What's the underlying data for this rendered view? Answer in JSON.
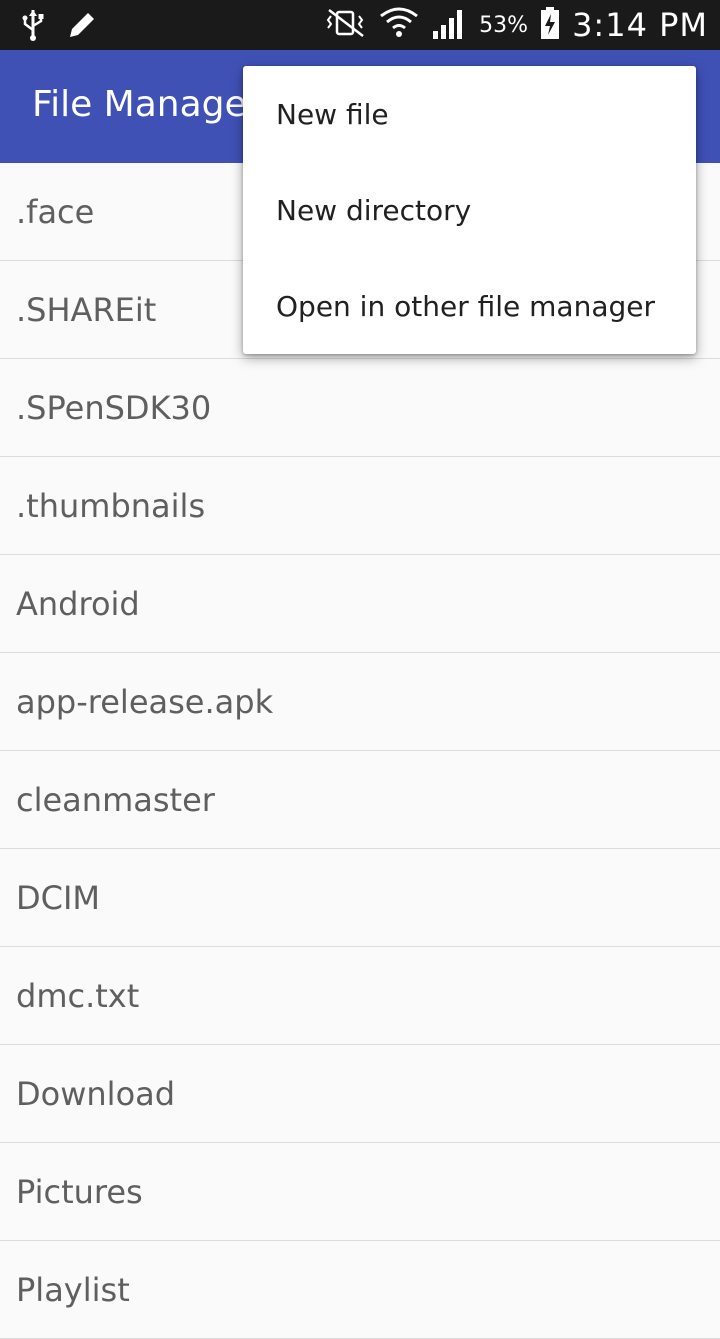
{
  "status_bar": {
    "icons_left": [
      "usb-icon",
      "edit-pencil-icon"
    ],
    "icons_right": [
      "vibrate-icon",
      "wifi-icon",
      "signal-icon",
      "battery-charging-icon"
    ],
    "battery_percent": "53%",
    "time": "3:14 PM"
  },
  "app_bar": {
    "title": "File Manager",
    "color": "#3f51b5"
  },
  "files": [
    {
      "name": ".face"
    },
    {
      "name": ".SHAREit"
    },
    {
      "name": ".SPenSDK30"
    },
    {
      "name": ".thumbnails"
    },
    {
      "name": "Android"
    },
    {
      "name": "app-release.apk"
    },
    {
      "name": "cleanmaster"
    },
    {
      "name": "DCIM"
    },
    {
      "name": "dmc.txt"
    },
    {
      "name": "Download"
    },
    {
      "name": "Pictures"
    },
    {
      "name": "Playlist"
    }
  ],
  "overflow_menu": {
    "items": [
      {
        "label": "New file"
      },
      {
        "label": "New directory"
      },
      {
        "label": "Open in other file manager"
      }
    ]
  }
}
